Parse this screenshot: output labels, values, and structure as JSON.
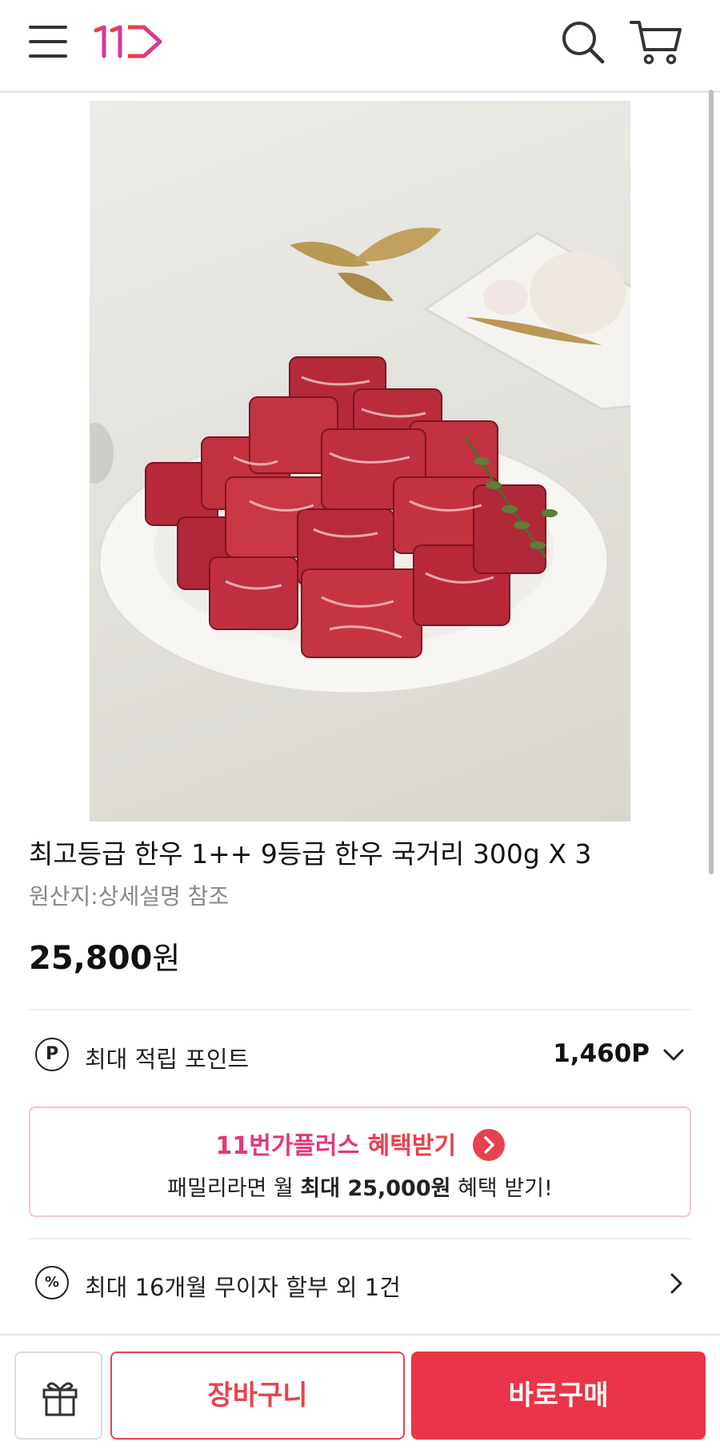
{
  "header": {
    "menu_icon": "hamburger-menu-icon",
    "logo_text": "11",
    "search_icon": "search-icon",
    "cart_icon": "shopping-cart-icon"
  },
  "product": {
    "image_subject": "marbled-beef-cubes-on-plate",
    "title": "최고등급 한우 1++ 9등급 한우 국거리 300g X 3",
    "origin": "원산지:상세설명 참조",
    "price": "25,800",
    "price_unit": "원"
  },
  "points": {
    "icon_letter": "P",
    "label": "최대 적립 포인트",
    "value": "1,460P"
  },
  "benefit": {
    "brand": "11번가플러스",
    "action": "혜택받기",
    "sub_prefix": "패밀리라면 월 ",
    "sub_bold": "최대 25,000원",
    "sub_suffix": " 혜택 받기!"
  },
  "installment": {
    "icon_symbol": "%",
    "label": "최대 16개월 무이자 할부 외 1건"
  },
  "bottom_bar": {
    "gift_icon": "gift-icon",
    "cart_label": "장바구니",
    "buy_label": "바로구매"
  },
  "colors": {
    "accent_red": "#ea3548",
    "brand_pink": "#e4377a",
    "benefit_border": "#f2c7cf"
  }
}
